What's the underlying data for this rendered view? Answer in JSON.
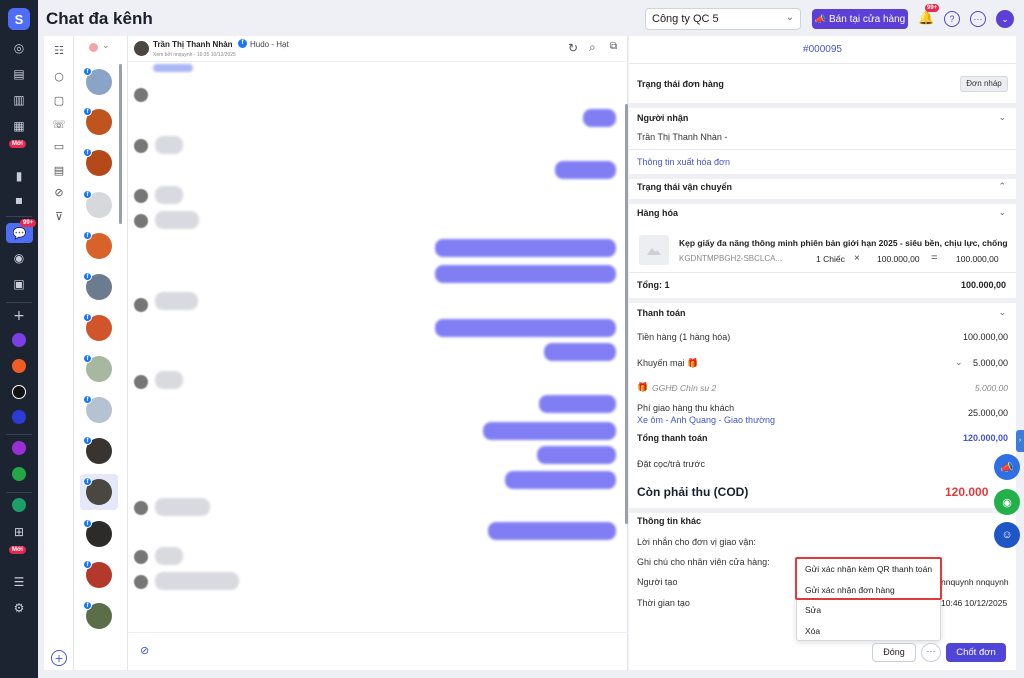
{
  "header": {
    "title": "Chat đa kênh",
    "company": "Công ty QC 5",
    "shop_button": "Bán tại cửa hàng",
    "notif_count": "99+"
  },
  "nav": {
    "badge_new": "Mới",
    "badge_new2": "Mới",
    "chat_badge": "99+"
  },
  "chat": {
    "contact_name": "Trần Thị Thanh Nhàn",
    "page_name": "Hudo - Hạt",
    "seen_by": "Xem bởi nnquynh - 10:35 10/12/2025"
  },
  "order": {
    "id": "#000095",
    "status_label": "Trạng thái đơn hàng",
    "status_value": "Đơn nháp",
    "recipient_title": "Người nhận",
    "recipient_name": "Trần Thị Thanh Nhàn -",
    "invoice_link": "Thông tin xuất hóa đơn",
    "shipping_title": "Trạng thái vận chuyển",
    "goods_title": "Hàng hóa",
    "product_name": "Kẹp giấy đa năng thông minh phiên bản giới hạn 2025 - siêu bền, chịu lực, chống",
    "product_sku": "KGDNTMPBGH2-SBCLCA...",
    "product_qty": "1 Chiếc",
    "product_price": "100.000,00",
    "product_total": "100.000,00",
    "total_label": "Tổng: 1",
    "total_value": "100.000,00",
    "payment_title": "Thanh toán",
    "subtotal_label": "Tiền hàng (1 hàng hóa)",
    "subtotal_value": "100.000,00",
    "promo_label": "Khuyến mại",
    "promo_value": "5.000,00",
    "voucher_label": "GGHĐ Chín su 2",
    "voucher_value": "5.000,00",
    "ship_fee_label": "Phí giao hàng thu khách",
    "ship_fee_value": "25.000,00",
    "carrier": "Xe ôm - Anh Quang - Giao thường",
    "grand_label": "Tổng thanh toán",
    "grand_value": "120.000,00",
    "deposit_label": "Đặt cọc/trả trước",
    "cod_label": "Còn phải thu (COD)",
    "cod_value": "120.000",
    "other_title": "Thông tin khác",
    "note_carrier": "Lời nhắn cho đơn vị giao vận:",
    "note_staff": "Ghi chú cho nhân viên cửa hàng:",
    "creator_label": "Người tạo",
    "creator_value": "nnquynh nnquynh",
    "created_label": "Thời gian tạo",
    "created_value": "10:46 10/12/2025"
  },
  "menu": {
    "items": [
      "Gửi xác nhận kèm QR thanh toán",
      "Gửi xác nhận đơn hàng",
      "Sửa",
      "Xóa"
    ]
  },
  "actions": {
    "close": "Đóng",
    "more": "···",
    "confirm": "Chốt đơn"
  },
  "colors": {
    "accent": "#5b3fd6",
    "nav_bg": "#1c2331",
    "link": "#4456c9",
    "danger": "#e03a3a"
  }
}
